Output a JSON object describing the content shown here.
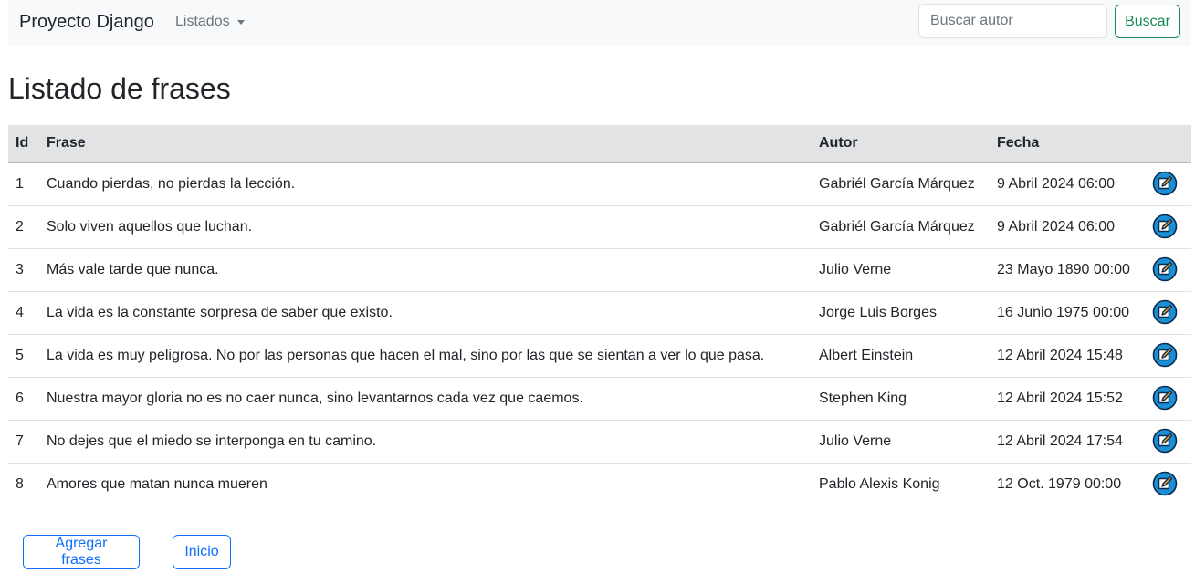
{
  "navbar": {
    "brand": "Proyecto Django",
    "dropdown_label": "Listados",
    "search_placeholder": "Buscar autor",
    "search_value": "",
    "search_button": "Buscar"
  },
  "page": {
    "title": "Listado de frases"
  },
  "table": {
    "headers": {
      "id": "Id",
      "frase": "Frase",
      "autor": "Autor",
      "fecha": "Fecha"
    },
    "rows": [
      {
        "id": "1",
        "frase": "Cuando pierdas, no pierdas la lección.",
        "autor": "Gabriél García Márquez",
        "fecha": "9 Abril 2024 06:00"
      },
      {
        "id": "2",
        "frase": "Solo viven aquellos que luchan.",
        "autor": "Gabriél García Márquez",
        "fecha": "9 Abril 2024 06:00"
      },
      {
        "id": "3",
        "frase": "Más vale tarde que nunca.",
        "autor": "Julio Verne",
        "fecha": "23 Mayo 1890 00:00"
      },
      {
        "id": "4",
        "frase": "La vida es la constante sorpresa de saber que existo.",
        "autor": "Jorge Luis Borges",
        "fecha": "16 Junio 1975 00:00"
      },
      {
        "id": "5",
        "frase": "La vida es muy peligrosa. No por las personas que hacen el mal, sino por las que se sientan a ver lo que pasa.",
        "autor": "Albert Einstein",
        "fecha": "12 Abril 2024 15:48"
      },
      {
        "id": "6",
        "frase": "Nuestra mayor gloria no es no caer nunca, sino levantarnos cada vez que caemos.",
        "autor": "Stephen King",
        "fecha": "12 Abril 2024 15:52"
      },
      {
        "id": "7",
        "frase": "No dejes que el miedo se interponga en tu camino.",
        "autor": "Julio Verne",
        "fecha": "12 Abril 2024 17:54"
      },
      {
        "id": "8",
        "frase": "Amores que matan nunca mueren",
        "autor": "Pablo Alexis Konig",
        "fecha": "12 Oct. 1979 00:00"
      }
    ],
    "edit_icon": "edit-pencil-icon"
  },
  "footer": {
    "add_button": "Agregar frases",
    "home_button": "Inicio"
  },
  "colors": {
    "navbar_bg": "#f8f9fa",
    "table_header_bg": "#e2e3e5",
    "success": "#198754",
    "primary": "#0d6efd",
    "edit_icon_fill": "#1a8fd6",
    "edit_icon_pencil": "#f0a030"
  }
}
